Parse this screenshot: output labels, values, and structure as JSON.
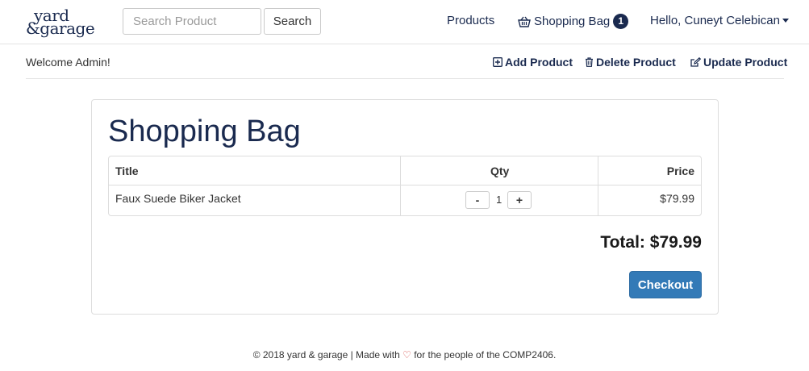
{
  "brand": {
    "line1": "yard",
    "line2": "&garage"
  },
  "search": {
    "placeholder": "Search Product",
    "button_label": "Search"
  },
  "nav": {
    "products": "Products",
    "shopping_bag": "Shopping Bag",
    "bag_count": "1",
    "user": "Hello, Cuneyt Celebican"
  },
  "admin": {
    "welcome": "Welcome Admin!",
    "add_product": "Add Product",
    "delete_product": "Delete Product",
    "update_product": "Update Product"
  },
  "bag": {
    "title": "Shopping Bag",
    "columns": {
      "title": "Title",
      "qty": "Qty",
      "price": "Price"
    },
    "items": [
      {
        "title": "Faux Suede Biker Jacket",
        "qty": "1",
        "price": "$79.99",
        "minus": "-",
        "plus": "+"
      }
    ],
    "total": "Total: $79.99",
    "checkout_label": "Checkout"
  },
  "footer": {
    "before": "© 2018 yard & garage | Made with",
    "heart": "♡",
    "after": "for the people of the COMP2406."
  },
  "colors": {
    "brand_navy": "#1a2a4f",
    "checkout_blue": "#337ab7",
    "heart_red": "#d9534f"
  }
}
